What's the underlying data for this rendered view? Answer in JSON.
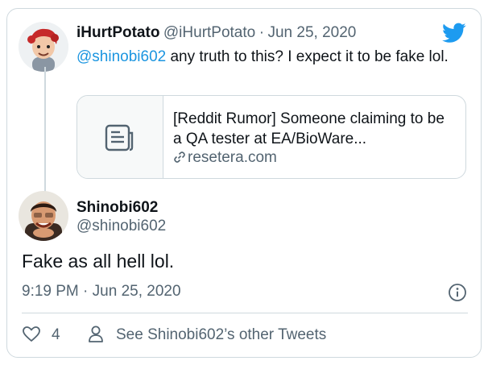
{
  "reply": {
    "display_name": "iHurtPotato",
    "handle": "@iHurtPotato",
    "separator": "·",
    "date": "Jun 25, 2020",
    "mention": "@shinobi602",
    "text": " any truth to this? I expect it to be fake lol.",
    "link_card": {
      "title": "[Reddit Rumor] Someone claiming to be a QA tester at EA/BioWare...",
      "domain": "resetera.com",
      "thumb_icon": "document-icon",
      "domain_icon": "link-icon"
    }
  },
  "tweet": {
    "display_name": "Shinobi602",
    "handle": "@shinobi602",
    "text": "Fake as all hell lol.",
    "time": "9:19 PM",
    "separator": "·",
    "date": "Jun 25, 2020",
    "info_icon": "info-icon"
  },
  "footer": {
    "like_icon": "heart-icon",
    "like_count": "4",
    "profile_icon": "person-icon",
    "profile_link": "See Shinobi602’s other Tweets"
  },
  "brand": {
    "logo": "twitter-bird-icon",
    "color": "#1d9bf0"
  },
  "colors": {
    "link": "#1b95e0",
    "secondary": "#536471",
    "border": "#cfd9de"
  }
}
